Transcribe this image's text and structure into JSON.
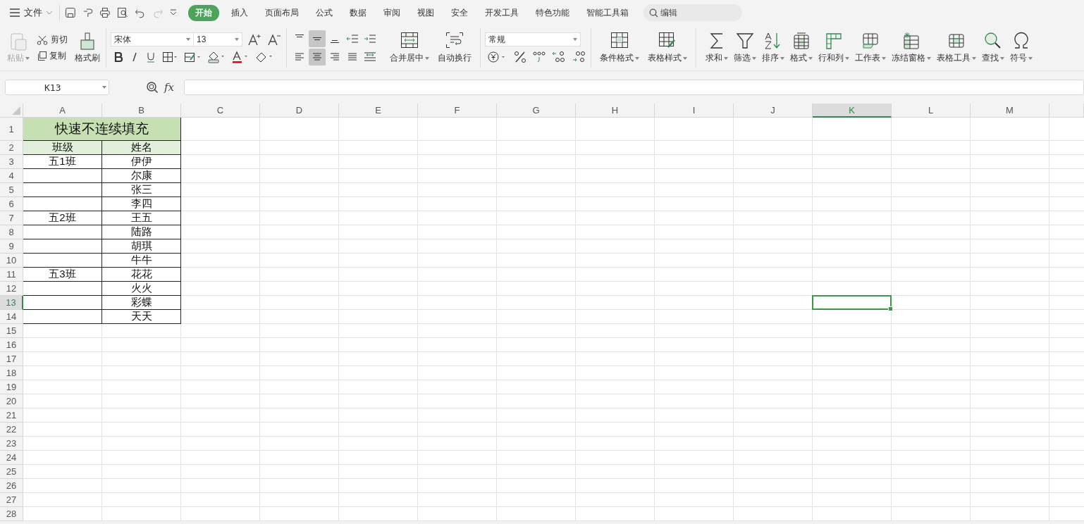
{
  "menu": {
    "file_label": "文件",
    "tabs": [
      {
        "label": "开始",
        "selected": true
      },
      {
        "label": "插入",
        "selected": false
      },
      {
        "label": "页面布局",
        "selected": false
      },
      {
        "label": "公式",
        "selected": false
      },
      {
        "label": "数据",
        "selected": false
      },
      {
        "label": "审阅",
        "selected": false
      },
      {
        "label": "视图",
        "selected": false
      },
      {
        "label": "安全",
        "selected": false
      },
      {
        "label": "开发工具",
        "selected": false
      },
      {
        "label": "特色功能",
        "selected": false
      },
      {
        "label": "智能工具箱",
        "selected": false
      }
    ],
    "search": {
      "placeholder": "编辑"
    }
  },
  "ribbon": {
    "clipboard": {
      "paste": {
        "label": "粘贴",
        "disabled": true
      },
      "cut": "剪切",
      "copy": "复制",
      "format_painter": "格式刷"
    },
    "font": {
      "name": "宋体",
      "size": "13"
    },
    "alignment": {
      "vertical": [
        {
          "selected": false
        },
        {
          "selected": true
        },
        {
          "selected": false
        }
      ],
      "horizontal": [
        {
          "selected": false
        },
        {
          "selected": true
        },
        {
          "selected": false
        },
        {
          "selected": false
        }
      ],
      "merge": "合并居中",
      "wrap": "自动换行"
    },
    "number": {
      "format": "常规"
    },
    "styles": [
      "条件格式",
      "表格样式"
    ],
    "tools": [
      "求和",
      "筛选",
      "排序",
      "格式",
      "行和列",
      "工作表",
      "冻结窗格",
      "表格工具",
      "查找",
      "符号"
    ]
  },
  "formula_bar": {
    "name_box": "K13",
    "fx_label": "fx"
  },
  "sheet": {
    "columns": [
      {
        "label": "A",
        "selected": false
      },
      {
        "label": "B",
        "selected": false
      },
      {
        "label": "C",
        "selected": false
      },
      {
        "label": "D",
        "selected": false
      },
      {
        "label": "E",
        "selected": false
      },
      {
        "label": "F",
        "selected": false
      },
      {
        "label": "G",
        "selected": false
      },
      {
        "label": "H",
        "selected": false
      },
      {
        "label": "I",
        "selected": false
      },
      {
        "label": "J",
        "selected": false
      },
      {
        "label": "K",
        "selected": true
      },
      {
        "label": "L",
        "selected": false
      },
      {
        "label": "M",
        "selected": false
      }
    ],
    "row_headers": [
      {
        "label": "1",
        "selected": false
      },
      {
        "label": "2",
        "selected": false
      },
      {
        "label": "3",
        "selected": false
      },
      {
        "label": "4",
        "selected": false
      },
      {
        "label": "5",
        "selected": false
      },
      {
        "label": "6",
        "selected": false
      },
      {
        "label": "7",
        "selected": false
      },
      {
        "label": "8",
        "selected": false
      },
      {
        "label": "9",
        "selected": false
      },
      {
        "label": "10",
        "selected": false
      },
      {
        "label": "11",
        "selected": false
      },
      {
        "label": "12",
        "selected": false
      },
      {
        "label": "13",
        "selected": true
      },
      {
        "label": "14",
        "selected": false
      },
      {
        "label": "15",
        "selected": false
      },
      {
        "label": "16",
        "selected": false
      },
      {
        "label": "17",
        "selected": false
      },
      {
        "label": "18",
        "selected": false
      },
      {
        "label": "19",
        "selected": false
      },
      {
        "label": "20",
        "selected": false
      },
      {
        "label": "21",
        "selected": false
      },
      {
        "label": "22",
        "selected": false
      },
      {
        "label": "23",
        "selected": false
      },
      {
        "label": "24",
        "selected": false
      },
      {
        "label": "25",
        "selected": false
      },
      {
        "label": "26",
        "selected": false
      },
      {
        "label": "27",
        "selected": false
      },
      {
        "label": "28",
        "selected": false
      }
    ],
    "title": "快速不连续填充",
    "headers": [
      "班级",
      "姓名"
    ],
    "rows": [
      {
        "class": "五1班",
        "name": "伊伊"
      },
      {
        "name": "尔康"
      },
      {
        "name": "张三"
      },
      {
        "name": "李四"
      },
      {
        "class": "五2班",
        "name": "王五"
      },
      {
        "name": "陆路"
      },
      {
        "name": "胡琪"
      },
      {
        "name": "牛牛"
      },
      {
        "class": "五3班",
        "name": "花花"
      },
      {
        "name": "火火"
      },
      {
        "name": "彩蝶"
      },
      {
        "name": "天天"
      }
    ]
  }
}
